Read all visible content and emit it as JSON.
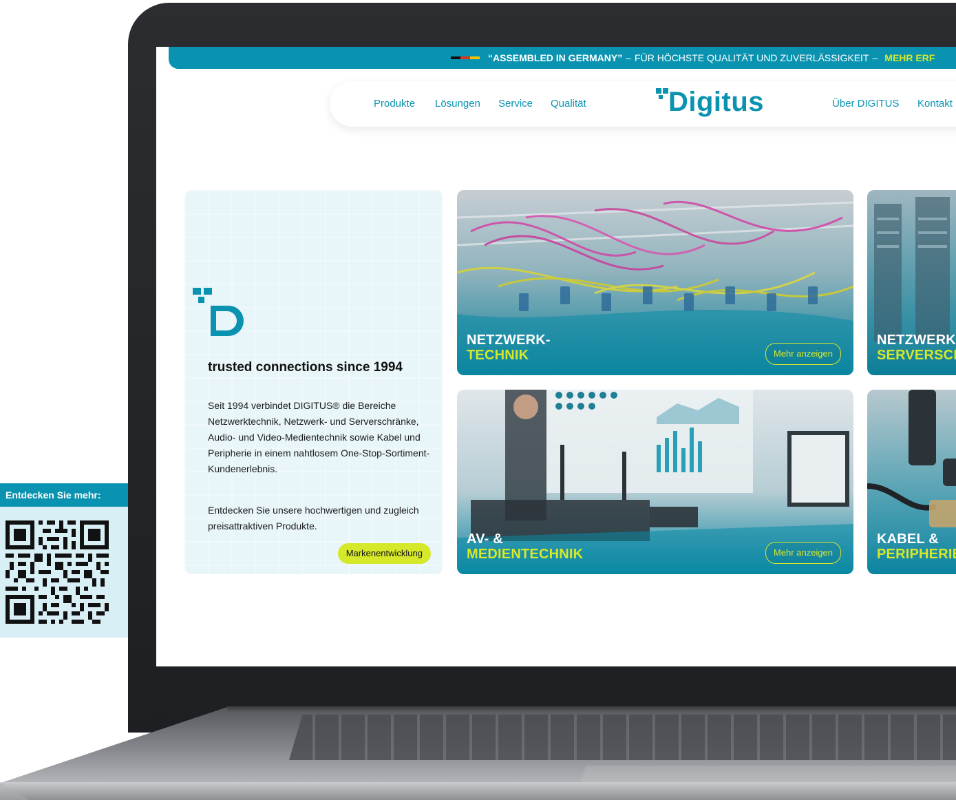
{
  "announcement": {
    "quote": "“ASSEMBLED IN GERMANY”",
    "separator": "–",
    "text": "FÜR HÖCHSTE QUALITÄT UND ZUVERLÄSSIGKEIT",
    "highlight": "MEHR ERF"
  },
  "nav": {
    "left": [
      "Produkte",
      "Lösungen",
      "Service",
      "Qualität"
    ],
    "logo_text": "Digitus",
    "right": [
      "Über DIGITUS",
      "Kontakt"
    ]
  },
  "intro": {
    "tagline": "trusted connections since 1994",
    "paragraph1": "Seit 1994 verbindet DIGITUS® die Bereiche Netzwerktechnik, Netzwerk- und Serverschränke, Audio- und Video-Medientechnik sowie Kabel und Peripherie in einem nahtlosem One-Stop-Sortiment-Kundenerlebnis.",
    "paragraph2": "Entdecken Sie unsere hochwertigen und zugleich preisattraktiven Produkte.",
    "button": "Markenentwicklung"
  },
  "cards": [
    {
      "line1": "NETZWERK-",
      "line2": "TECHNIK",
      "button": "Mehr anzeigen"
    },
    {
      "line1": "NETZWERK",
      "line2": "SERVERSCH",
      "button": ""
    },
    {
      "line1": "AV- &",
      "line2": "MEDIENTECHNIK",
      "button": "Mehr anzeigen"
    },
    {
      "line1": "KABEL &",
      "line2": "PERIPHERIE",
      "button": ""
    }
  ],
  "qr": {
    "label": "Entdecken Sie mehr:"
  },
  "colors": {
    "brand": "#0a93b0",
    "accent": "#d6e82a",
    "card_bg": "#e8f5f9"
  }
}
